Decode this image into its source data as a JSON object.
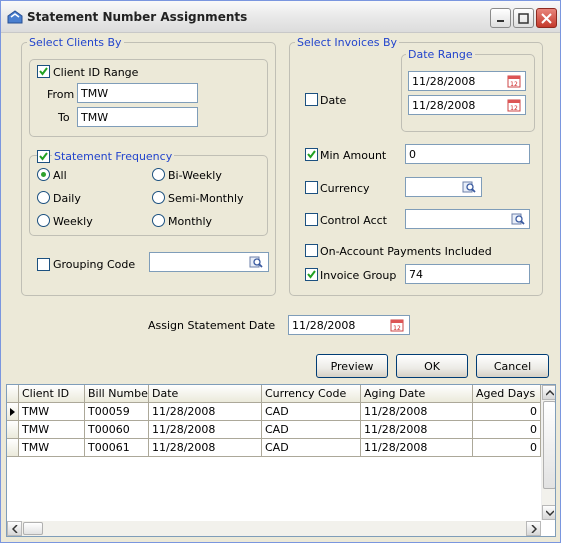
{
  "window": {
    "title": "Statement Number Assignments"
  },
  "clients": {
    "legend": "Select Clients By",
    "client_id_range_label": "Client ID Range",
    "client_id_range_checked": true,
    "from_label": "From",
    "from_value": "TMW",
    "to_label": "To",
    "to_value": "TMW",
    "frequency": {
      "legend": "Statement Frequency",
      "checked": true,
      "options": [
        "All",
        "Bi-Weekly",
        "Daily",
        "Semi-Monthly",
        "Weekly",
        "Monthly"
      ],
      "selected": "All"
    },
    "grouping_code_label": "Grouping Code",
    "grouping_code_checked": false,
    "grouping_code_value": ""
  },
  "invoices": {
    "legend": "Select Invoices By",
    "date_label": "Date",
    "date_checked": false,
    "date_range": {
      "legend": "Date Range",
      "start": "11/28/2008",
      "end": "11/28/2008"
    },
    "min_amount_label": "Min Amount",
    "min_amount_checked": true,
    "min_amount_value": "0",
    "currency_label": "Currency",
    "currency_checked": false,
    "currency_value": "",
    "control_acct_label": "Control Acct",
    "control_acct_checked": false,
    "control_acct_value": "",
    "on_account_label": "On-Account Payments Included",
    "on_account_checked": false,
    "invoice_group_label": "Invoice Group",
    "invoice_group_checked": true,
    "invoice_group_value": "74"
  },
  "assign": {
    "label": "Assign Statement Date",
    "value": "11/28/2008"
  },
  "buttons": {
    "preview": "Preview",
    "ok": "OK",
    "cancel": "Cancel"
  },
  "grid": {
    "columns": [
      "Client ID",
      "Bill Number",
      "Date",
      "Currency Code",
      "Aging Date",
      "Aged Days"
    ],
    "rows": [
      [
        "TMW",
        "T00059",
        "11/28/2008",
        "CAD",
        "11/28/2008",
        "0"
      ],
      [
        "TMW",
        "T00060",
        "11/28/2008",
        "CAD",
        "11/28/2008",
        "0"
      ],
      [
        "TMW",
        "T00061",
        "11/28/2008",
        "CAD",
        "11/28/2008",
        "0"
      ]
    ]
  },
  "colors": {
    "legend_text": "#2244cc",
    "window_bg": "#ECE9D8",
    "check_green": "#21a121"
  }
}
